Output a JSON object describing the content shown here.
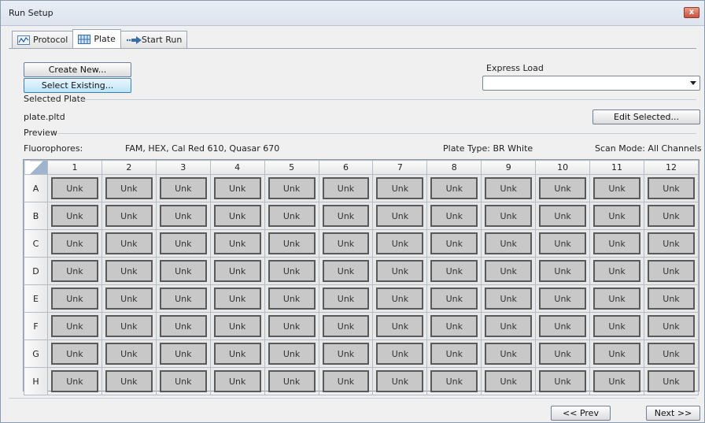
{
  "window": {
    "title": "Run Setup",
    "close_label": "x"
  },
  "tabs": [
    {
      "label": "Protocol",
      "icon": "protocol-chart-icon"
    },
    {
      "label": "Plate",
      "icon": "plate-grid-icon"
    },
    {
      "label": "Start Run",
      "icon": "arrow-right-icon"
    }
  ],
  "buttons": {
    "create_new": "Create New...",
    "select_existing": "Select Existing...",
    "edit_selected": "Edit Selected...",
    "prev": "<< Prev",
    "next": "Next >>"
  },
  "express_load": {
    "label": "Express Load",
    "value": ""
  },
  "selected_plate": {
    "label": "Selected Plate",
    "file": "plate.pltd"
  },
  "preview": {
    "label": "Preview",
    "fluorophores_label": "Fluorophores:",
    "fluorophores_value": "FAM, HEX, Cal Red 610, Quasar 670",
    "plate_type": "Plate Type: BR White",
    "scan_mode": "Scan Mode: All Channels"
  },
  "plate": {
    "columns": [
      "1",
      "2",
      "3",
      "4",
      "5",
      "6",
      "7",
      "8",
      "9",
      "10",
      "11",
      "12"
    ],
    "rows": [
      {
        "label": "A",
        "wells": [
          "Unk",
          "Unk",
          "Unk",
          "Unk",
          "Unk",
          "Unk",
          "Unk",
          "Unk",
          "Unk",
          "Unk",
          "Unk",
          "Unk"
        ]
      },
      {
        "label": "B",
        "wells": [
          "Unk",
          "Unk",
          "Unk",
          "Unk",
          "Unk",
          "Unk",
          "Unk",
          "Unk",
          "Unk",
          "Unk",
          "Unk",
          "Unk"
        ]
      },
      {
        "label": "C",
        "wells": [
          "Unk",
          "Unk",
          "Unk",
          "Unk",
          "Unk",
          "Unk",
          "Unk",
          "Unk",
          "Unk",
          "Unk",
          "Unk",
          "Unk"
        ]
      },
      {
        "label": "D",
        "wells": [
          "Unk",
          "Unk",
          "Unk",
          "Unk",
          "Unk",
          "Unk",
          "Unk",
          "Unk",
          "Unk",
          "Unk",
          "Unk",
          "Unk"
        ]
      },
      {
        "label": "E",
        "wells": [
          "Unk",
          "Unk",
          "Unk",
          "Unk",
          "Unk",
          "Unk",
          "Unk",
          "Unk",
          "Unk",
          "Unk",
          "Unk",
          "Unk"
        ]
      },
      {
        "label": "F",
        "wells": [
          "Unk",
          "Unk",
          "Unk",
          "Unk",
          "Unk",
          "Unk",
          "Unk",
          "Unk",
          "Unk",
          "Unk",
          "Unk",
          "Unk"
        ]
      },
      {
        "label": "G",
        "wells": [
          "Unk",
          "Unk",
          "Unk",
          "Unk",
          "Unk",
          "Unk",
          "Unk",
          "Unk",
          "Unk",
          "Unk",
          "Unk",
          "Unk"
        ]
      },
      {
        "label": "H",
        "wells": [
          "Unk",
          "Unk",
          "Unk",
          "Unk",
          "Unk",
          "Unk",
          "Unk",
          "Unk",
          "Unk",
          "Unk",
          "Unk",
          "Unk"
        ]
      }
    ]
  }
}
